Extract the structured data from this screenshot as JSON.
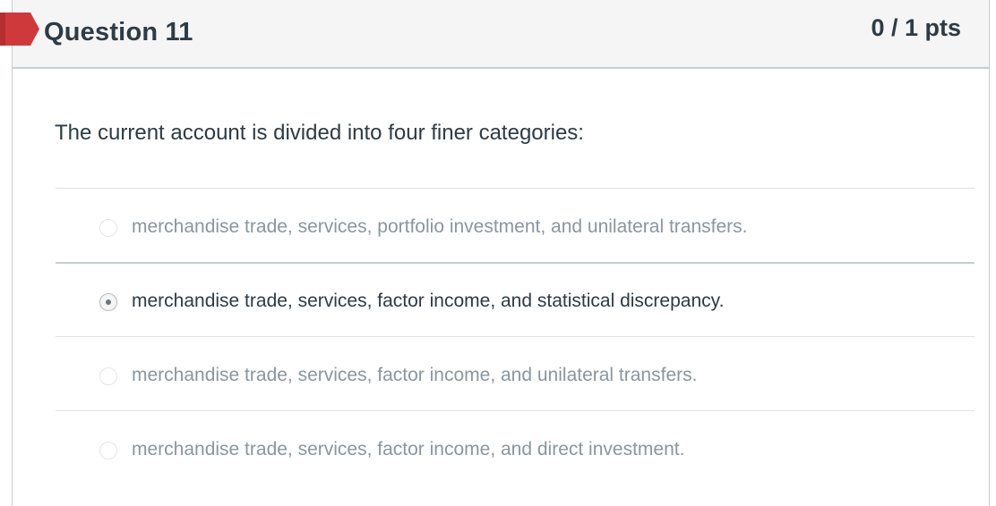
{
  "question": {
    "title": "Question 11",
    "points": "0 / 1 pts",
    "text": "The current account is divided into four finer categories:",
    "status_color": "#d0393b",
    "flag_icon": "incorrect-flag-icon"
  },
  "answers": [
    {
      "label": "merchandise trade, services, portfolio investment, and unilateral transfers.",
      "selected": false
    },
    {
      "label": "merchandise trade, services, factor income, and statistical discrepancy.",
      "selected": true
    },
    {
      "label": "merchandise trade, services, factor income, and unilateral transfers.",
      "selected": false
    },
    {
      "label": "merchandise trade, services, factor income, and direct investment.",
      "selected": false
    }
  ]
}
